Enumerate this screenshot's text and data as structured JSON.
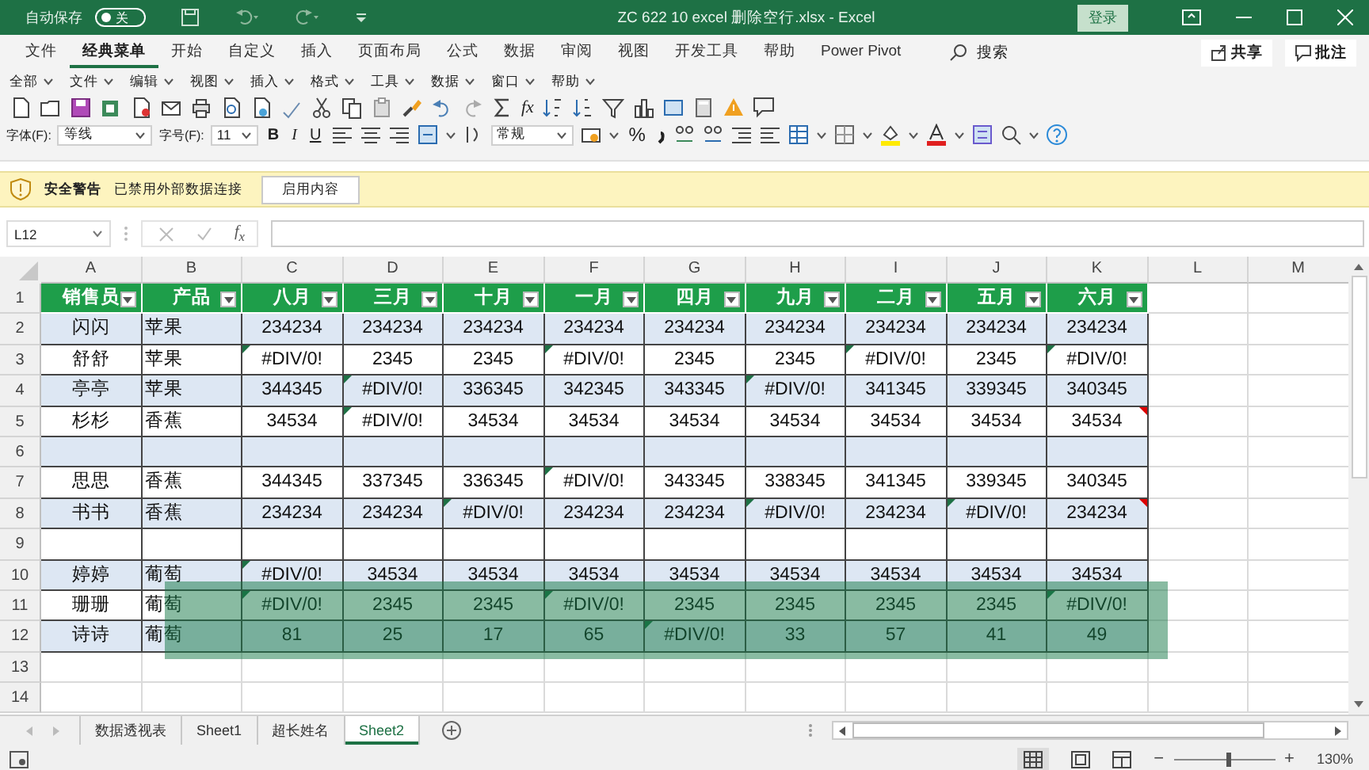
{
  "title_bar": {
    "autosave_label": "自动保存",
    "autosave_toggle": {
      "on": false,
      "label": "关"
    },
    "title": "ZC 622 10 excel 删除空行.xlsx  -  Excel",
    "login_button": "登录"
  },
  "ribbon_tabs": [
    {
      "label": "文件",
      "selected": false
    },
    {
      "label": "经典菜单",
      "selected": true
    },
    {
      "label": "开始",
      "selected": false
    },
    {
      "label": "自定义",
      "selected": false
    },
    {
      "label": "插入",
      "selected": false
    },
    {
      "label": "页面布局",
      "selected": false
    },
    {
      "label": "公式",
      "selected": false
    },
    {
      "label": "数据",
      "selected": false
    },
    {
      "label": "审阅",
      "selected": false
    },
    {
      "label": "视图",
      "selected": false
    },
    {
      "label": "开发工具",
      "selected": false
    },
    {
      "label": "帮助",
      "selected": false
    },
    {
      "label": "Power Pivot",
      "selected": false
    }
  ],
  "search": {
    "label": "搜索"
  },
  "share_button": "共享",
  "comments_button": "批注",
  "classic_menu": [
    "全部",
    "文件",
    "编辑",
    "视图",
    "插入",
    "格式",
    "工具",
    "数据",
    "窗口",
    "帮助"
  ],
  "font_row": {
    "font_label": "字体(F):",
    "font": "等线",
    "size_label": "字号(F):",
    "size": "11",
    "bold": "B",
    "italic": "I",
    "underline": "U",
    "number_format": "常规",
    "percent": "%"
  },
  "toolbar": {
    "function": "fx"
  },
  "security_bar": {
    "title": "安全警告",
    "message": "已禁用外部数据连接",
    "button": "启用内容"
  },
  "formula_bar": {
    "name_box": "L12",
    "function_label": "f$_{x}$"
  },
  "sheet": {
    "columns": [
      "A",
      "B",
      "C",
      "D",
      "E",
      "F",
      "G",
      "H",
      "I",
      "J",
      "K",
      "L",
      "M"
    ],
    "row_numbers": [
      "1",
      "2",
      "3",
      "4",
      "5",
      "6",
      "7",
      "8",
      "9",
      "10",
      "11",
      "12",
      "13",
      "14"
    ],
    "header": [
      "销售员",
      "产品",
      "八月",
      "三月",
      "十月",
      "一月",
      "四月",
      "九月",
      "二月",
      "五月",
      "六月"
    ],
    "rows": [
      {
        "cells": [
          "闪闪",
          "苹果",
          "234234",
          "234234",
          "234234",
          "234234",
          "234234",
          "234234",
          "234234",
          "234234",
          "234234"
        ]
      },
      {
        "cells": [
          "舒舒",
          "苹果",
          {
            "text": "#DIV/0!",
            "error_indicator": true
          },
          "2345",
          "2345",
          {
            "text": "#DIV/0!",
            "error_indicator": true
          },
          "2345",
          "2345",
          {
            "text": "#DIV/0!",
            "error_indicator": true
          },
          "2345",
          {
            "text": "#DIV/0!",
            "error_indicator": true
          }
        ]
      },
      {
        "cells": [
          "亭亭",
          "苹果",
          "344345",
          {
            "text": "#DIV/0!",
            "error_indicator": true
          },
          "336345",
          "342345",
          "343345",
          {
            "text": "#DIV/0!",
            "error_indicator": true
          },
          "341345",
          "339345",
          "340345"
        ]
      },
      {
        "cells": [
          "杉杉",
          "香蕉",
          "34534",
          {
            "text": "#DIV/0!",
            "error_indicator": true
          },
          "34534",
          "34534",
          "34534",
          "34534",
          "34534",
          "34534",
          {
            "text": "34534",
            "comment_indicator": true
          }
        ]
      },
      {
        "empty": true
      },
      {
        "cells": [
          "思思",
          "香蕉",
          "344345",
          "337345",
          "336345",
          {
            "text": "#DIV/0!",
            "error_indicator": true
          },
          "343345",
          "338345",
          "341345",
          "339345",
          "340345"
        ]
      },
      {
        "cells": [
          "书书",
          "香蕉",
          "234234",
          "234234",
          {
            "text": "#DIV/0!",
            "error_indicator": true
          },
          "234234",
          "234234",
          {
            "text": "#DIV/0!",
            "error_indicator": true
          },
          "234234",
          {
            "text": "#DIV/0!",
            "error_indicator": true
          },
          {
            "text": "234234",
            "comment_indicator": true
          }
        ]
      },
      {
        "empty": true
      },
      {
        "cells": [
          "婷婷",
          "葡萄",
          {
            "text": "#DIV/0!",
            "error_indicator": true
          },
          "34534",
          "34534",
          "34534",
          "34534",
          "34534",
          "34534",
          "34534",
          "34534"
        ]
      },
      {
        "cells": [
          "珊珊",
          "葡萄",
          {
            "text": "#DIV/0!",
            "error_indicator": true
          },
          "2345",
          "2345",
          {
            "text": "#DIV/0!",
            "error_indicator": true
          },
          "2345",
          "2345",
          "2345",
          "2345",
          {
            "text": "#DIV/0!",
            "error_indicator": true
          }
        ]
      },
      {
        "cells": [
          "诗诗",
          "葡萄",
          "81",
          "25",
          "17",
          "65",
          {
            "text": "#DIV/0!",
            "error_indicator": true
          },
          "33",
          "57",
          "41",
          "49"
        ]
      }
    ]
  },
  "sheet_tabs": [
    {
      "label": "数据透视表",
      "selected": false
    },
    {
      "label": "Sheet1",
      "selected": false
    },
    {
      "label": "超长姓名",
      "selected": false
    },
    {
      "label": "Sheet2",
      "selected": true
    }
  ],
  "status_bar": {
    "zoom_out": "−",
    "zoom_in": "+",
    "zoom_slider": {
      "level": 0.54
    },
    "zoom": "130%"
  }
}
